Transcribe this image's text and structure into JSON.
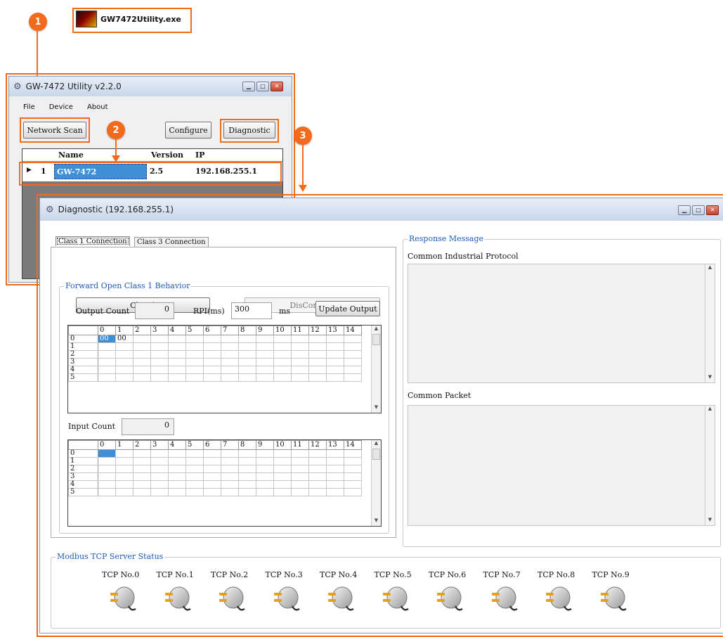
{
  "exe": {
    "name": "GW7472Utility.exe"
  },
  "steps": [
    "1",
    "2",
    "3"
  ],
  "utility": {
    "title": "GW-7472 Utility v2.2.0",
    "menu": [
      "File",
      "Device",
      "About"
    ],
    "network_scan": "Network Scan",
    "configure": "Configure",
    "diagnostic": "Diagnostic",
    "columns": [
      "Name",
      "Version",
      "IP"
    ],
    "rows": [
      {
        "index": "1",
        "name": "GW-7472",
        "version": "2.5",
        "ip": "192.168.255.1"
      }
    ]
  },
  "diag": {
    "title": "Diagnostic (192.168.255.1)",
    "tabs": [
      "Class 1 Connection",
      "Class 3 Connection"
    ],
    "forward_group": "Forward Open Class 1 Behavior",
    "class1": "Class1",
    "disconnect": "DisConnect",
    "output_count_label": "Output Count",
    "output_count": "0",
    "rpi_label": "RPI(ms)",
    "rpi_value": "300",
    "rpi_unit": "ms",
    "update_output": "Update Output",
    "input_count_label": "Input Count",
    "input_count": "0",
    "output_grid": {
      "columns": [
        "0",
        "1",
        "2",
        "3",
        "4",
        "5",
        "6",
        "7",
        "8",
        "9",
        "10",
        "11",
        "12",
        "13",
        "14"
      ],
      "rows": [
        "0",
        "1",
        "2",
        "3",
        "4",
        "5"
      ],
      "values": [
        [
          "00",
          "00"
        ]
      ]
    },
    "input_grid": {
      "columns": [
        "0",
        "1",
        "2",
        "3",
        "4",
        "5",
        "6",
        "7",
        "8",
        "9",
        "10",
        "11",
        "12",
        "13",
        "14"
      ],
      "rows": [
        "0",
        "1",
        "2",
        "3",
        "4",
        "5"
      ]
    },
    "response_group": "Response Message",
    "cip_label": "Common Industrial Protocol",
    "packet_label": "Common Packet",
    "modbus_group": "Modbus TCP Server Status",
    "tcp": [
      "TCP No.0",
      "TCP No.1",
      "TCP No.2",
      "TCP No.3",
      "TCP No.4",
      "TCP No.5",
      "TCP No.6",
      "TCP No.7",
      "TCP No.8",
      "TCP No.9"
    ]
  },
  "colors": {
    "accent": "#f26a1b",
    "selection": "#3e8fd8",
    "legend": "#1e5dbb"
  }
}
